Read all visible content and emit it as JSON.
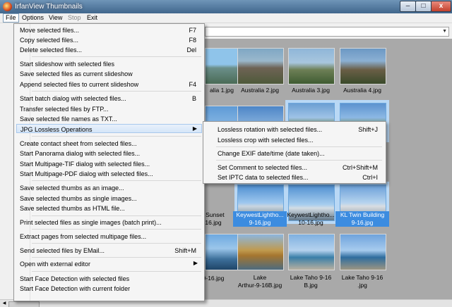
{
  "window": {
    "title": "IrfanView Thumbnails"
  },
  "window_controls": {
    "minimize": "–",
    "maximize": "□",
    "close": "x"
  },
  "menubar": {
    "file": "File",
    "options": "Options",
    "view": "View",
    "stop": "Stop",
    "exit": "Exit"
  },
  "file_menu": [
    {
      "label": "Move selected files...",
      "shortcut": "F7"
    },
    {
      "label": "Copy selected files...",
      "shortcut": "F8"
    },
    {
      "label": "Delete selected files...",
      "shortcut": "Del"
    },
    {
      "label": "Start slideshow with selected files",
      "shortcut": ""
    },
    {
      "label": "Save selected files as current slideshow",
      "shortcut": ""
    },
    {
      "label": "Append selected files to current slideshow",
      "shortcut": "F4"
    },
    {
      "label": "Start batch dialog with selected files...",
      "shortcut": "B"
    },
    {
      "label": "Transfer selected files by FTP...",
      "shortcut": ""
    },
    {
      "label": "Save selected file names as TXT...",
      "shortcut": ""
    },
    {
      "label": "JPG Lossless Operations",
      "shortcut": ""
    },
    {
      "label": "Create contact sheet from selected files...",
      "shortcut": ""
    },
    {
      "label": "Start Panorama dialog with selected files...",
      "shortcut": ""
    },
    {
      "label": "Start Multipage-TIF dialog with selected files...",
      "shortcut": ""
    },
    {
      "label": "Start Multipage-PDF dialog with selected files...",
      "shortcut": ""
    },
    {
      "label": "Save selected thumbs as an image...",
      "shortcut": ""
    },
    {
      "label": "Save selected thumbs as single images...",
      "shortcut": ""
    },
    {
      "label": "Save selected thumbs as HTML file...",
      "shortcut": ""
    },
    {
      "label": "Print selected files as single images (batch print)...",
      "shortcut": ""
    },
    {
      "label": "Extract pages from selected multipage files...",
      "shortcut": ""
    },
    {
      "label": "Send selected files by EMail...",
      "shortcut": "Shift+M"
    },
    {
      "label": "Open with external editor",
      "shortcut": ""
    },
    {
      "label": "Start Face Detection with selected files",
      "shortcut": ""
    },
    {
      "label": "Start Face Detection with current folder",
      "shortcut": ""
    }
  ],
  "submenu": [
    {
      "label": "Lossless rotation with selected files...",
      "shortcut": "Shift+J"
    },
    {
      "label": "Lossless crop with selected files...",
      "shortcut": ""
    },
    {
      "label": "Change EXIF date/time (date taken)...",
      "shortcut": ""
    },
    {
      "label": "Set Comment to selected files...",
      "shortcut": "Ctrl+Shift+M"
    },
    {
      "label": "Set IPTC data to selected files...",
      "shortcut": "Ctrl+I"
    }
  ],
  "thumbnails": [
    {
      "caption": "alia 1.jpg"
    },
    {
      "caption": "Australia 2.jpg"
    },
    {
      "caption": "Australia 3.jpg"
    },
    {
      "caption": "Australia 4.jpg"
    },
    {
      "caption": "t Sunset"
    },
    {
      "caption": "KeywestLightho..."
    },
    {
      "caption": "KeywestLightho..."
    },
    {
      "caption": "KL Twin Building"
    },
    {
      "caption": "9-16.jpg"
    },
    {
      "caption": "Lake"
    },
    {
      "caption": "Lake"
    },
    {
      "caption": "Lake Taho 9-16"
    },
    {
      "caption": "Lake Taho 9-16"
    }
  ],
  "captions_line2": {
    "sunset": "16.jpg",
    "kw1": "9-16.jpg",
    "kw2": "10-16.jpg",
    "kl": "9-16.jpg",
    "lake1": "Arthur-9-16B.jpg",
    "lake2": "B.jpg",
    "lake3": ".jpg"
  },
  "colors": {
    "selection": "#3c8ce0",
    "title_bar": "#40668c",
    "background": "#a9a9a9"
  }
}
